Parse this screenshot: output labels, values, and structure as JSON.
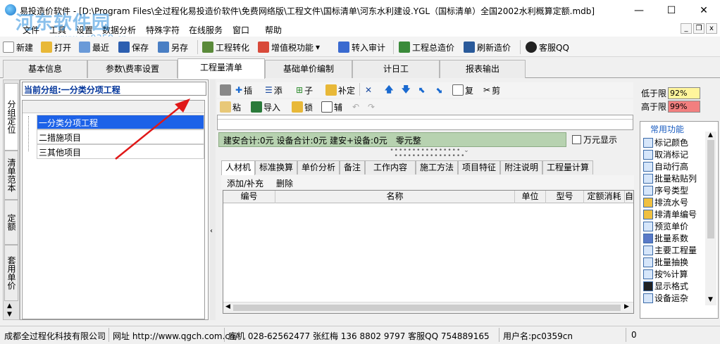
{
  "window": {
    "title": "易投造价软件 - [D:\\Program Files\\全过程化易投造价软件\\免费网络版\\工程文件\\国标清单\\河东水利建设.YGL（国标清单）全国2002水利概算定额.mdb]",
    "min_icon": "minimize-icon",
    "max_icon": "maximize-icon",
    "close_icon": "close-icon"
  },
  "watermark": {
    "text": "河东软件园",
    "url": "www.pc0359.cn"
  },
  "menu": [
    "文件",
    "工具",
    "设置",
    "数据分析",
    "特殊字符",
    "在线服务",
    "窗口",
    "帮助"
  ],
  "toolbar": [
    {
      "label": "新建",
      "icon": "new-icon"
    },
    {
      "label": "打开",
      "icon": "open-icon"
    },
    {
      "label": "最近",
      "icon": "recent-icon"
    },
    {
      "label": "保存",
      "icon": "save-icon"
    },
    {
      "label": "另存",
      "icon": "save-as-icon"
    },
    {
      "label": "工程转化",
      "icon": "convert-icon"
    },
    {
      "label": "增值税功能",
      "icon": "vat-icon"
    },
    {
      "label": "转入审计",
      "icon": "audit-icon"
    },
    {
      "label": "工程总造价",
      "icon": "home-icon"
    },
    {
      "label": "刷新造价",
      "icon": "refresh-icon"
    },
    {
      "label": "客服QQ",
      "icon": "qq-icon"
    }
  ],
  "tabs": [
    "基本信息",
    "参数\\费率设置",
    "工程量清单",
    "基础单价编制",
    "计日工",
    "报表输出"
  ],
  "active_tab": "工程量清单",
  "side_tabs": [
    "分组定位",
    "清单范本",
    "定额",
    "套用单价"
  ],
  "current_group": "当前分组:一分类分项工程",
  "tree": [
    "一分类分项工程",
    "二措施项目",
    "三其他项目"
  ],
  "rtool1": [
    "插",
    "添",
    "子",
    "补定",
    "",
    "",
    "",
    "",
    "复",
    "剪"
  ],
  "rtool2": [
    "粘",
    "导入",
    "锁",
    "辅"
  ],
  "summary": "建安合计:0元 设备合计:0元 建安+设备:0元　零元整",
  "wan_label": "万元显示",
  "subtabs": [
    "人材机",
    "标准换算",
    "单价分析",
    "备注",
    "工作内容",
    "施工方法",
    "项目特征",
    "附注说明",
    "工程量计算"
  ],
  "subtool": [
    "添加/补充",
    "删除"
  ],
  "grid_cols": [
    "编号",
    "名称",
    "单位",
    "型号",
    "定额消耗",
    "自"
  ],
  "limits": {
    "low_label": "低于限",
    "low_val": "92%",
    "high_label": "高于限",
    "high_val": "99%",
    "low_color": "#fff59c",
    "high_color": "#f27f7f"
  },
  "funcs_title": "常用功能",
  "funcs": [
    "标记颜色",
    "取消标记",
    "自动行高",
    "批量粘贴列",
    "序号类型",
    "排流水号",
    "排清单编号",
    "预览单价",
    "批量系数",
    "主要工程量",
    "批量抽换",
    "按%计算",
    "显示格式",
    "设备运杂"
  ],
  "status": {
    "company": "成都全过程化科技有限公司",
    "site": "网址 http://www.qgch.com.cn/",
    "contact": "座机 028-62562477  张红梅 136 8802 9797  客服QQ 754889165",
    "user": "用户名:pc0359cn",
    "zero": "0"
  }
}
